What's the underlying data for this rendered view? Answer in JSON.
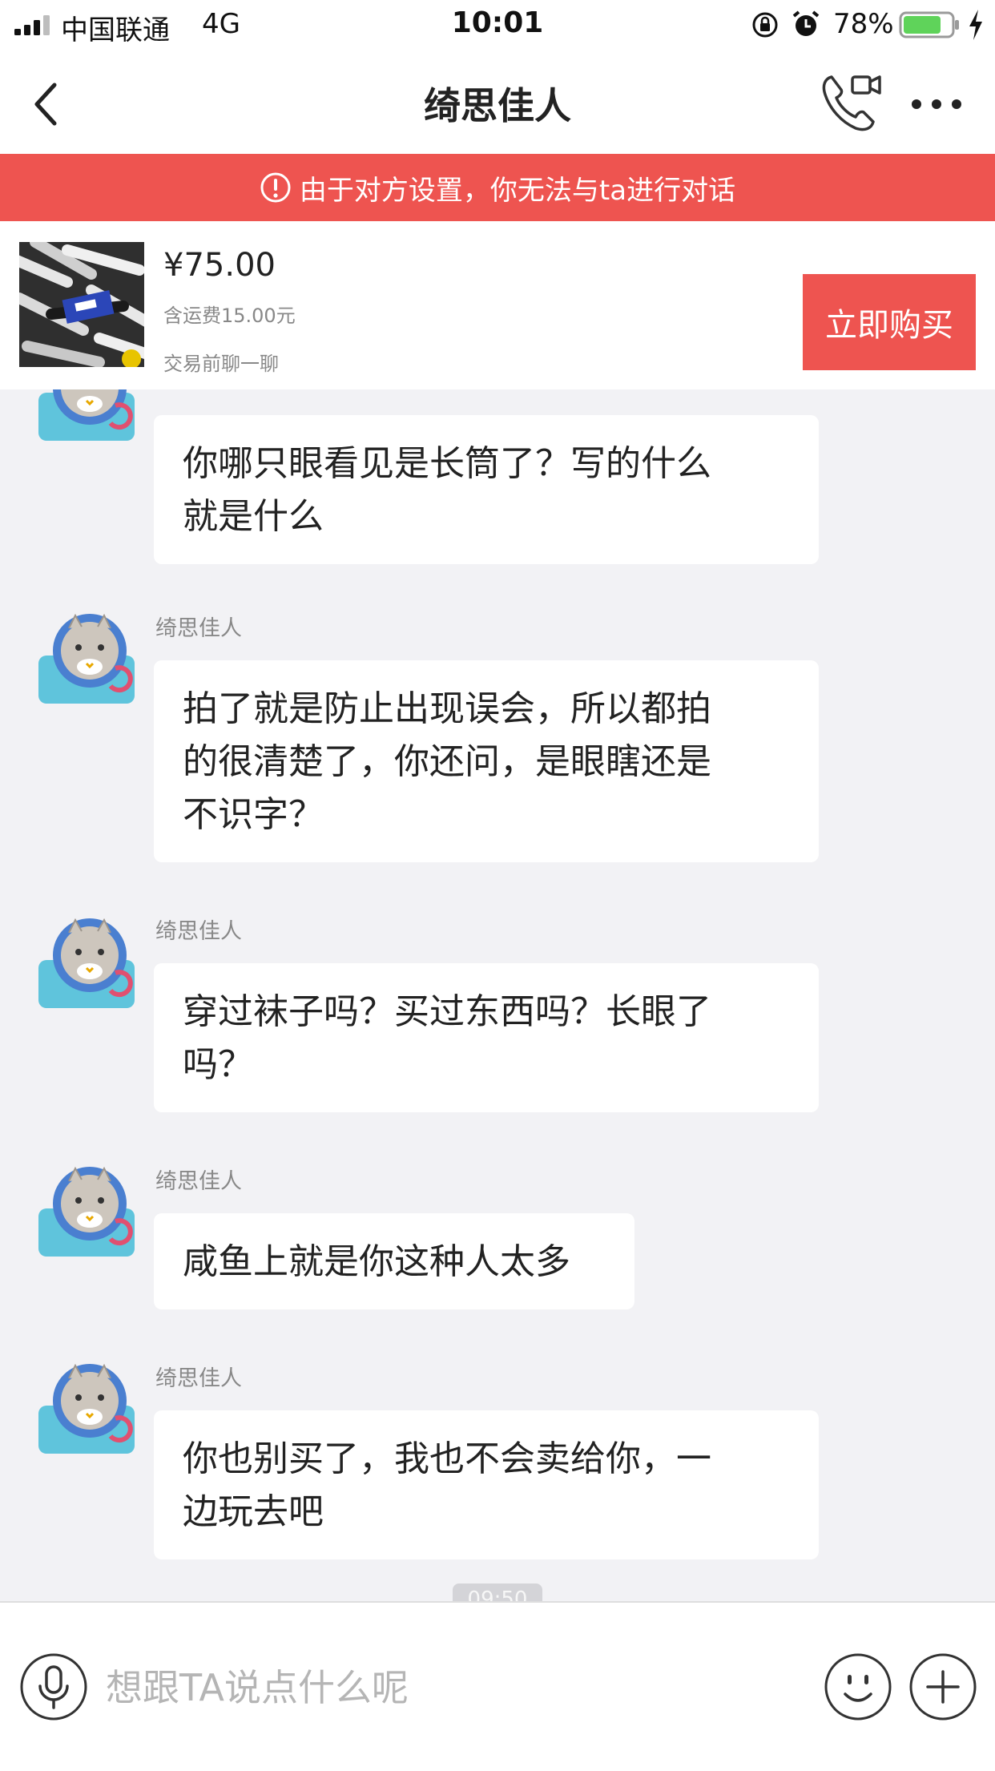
{
  "status_bar": {
    "carrier": "中国联通",
    "network": "4G",
    "time": "10:01",
    "battery_percent": "78%",
    "icons": [
      "signal-icon",
      "rotation-lock-icon",
      "alarm-icon",
      "battery-icon",
      "charging-icon"
    ]
  },
  "nav": {
    "title": "绮思佳人",
    "icons": [
      "back-icon",
      "phone-video-icon",
      "more-icon"
    ]
  },
  "banner": {
    "text": "由于对方设置，你无法与ta进行对话",
    "icon": "warning-icon"
  },
  "product": {
    "price": "¥75.00",
    "shipping": "含运费15.00元",
    "hint": "交易前聊一聊",
    "buy_label": "立即购买"
  },
  "messages": [
    {
      "sender": "",
      "text_lines": [
        "你哪只眼看见是长筒了？写的什么",
        "就是什么"
      ]
    },
    {
      "sender": "绮思佳人",
      "text_lines": [
        "拍了就是防止出现误会，所以都拍",
        "的很清楚了，你还问，是眼瞎还是",
        "不识字？"
      ]
    },
    {
      "sender": "绮思佳人",
      "text_lines": [
        "穿过袜子吗？买过东西吗？长眼了",
        "吗？"
      ]
    },
    {
      "sender": "绮思佳人",
      "text_lines": [
        "咸鱼上就是你这种人太多"
      ]
    },
    {
      "sender": "绮思佳人",
      "text_lines": [
        "你也别买了，我也不会卖给你，一",
        "边玩去吧"
      ]
    }
  ],
  "timestamp_partial": "09:50",
  "input": {
    "placeholder": "想跟TA说点什么呢",
    "value": "",
    "icons": [
      "microphone-icon",
      "emoji-icon",
      "plus-icon"
    ]
  },
  "colors": {
    "accent_red": "#ee5450",
    "chat_background": "#f2f2f5",
    "bubble_background": "#ffffff",
    "battery_green": "#5fd35a"
  }
}
